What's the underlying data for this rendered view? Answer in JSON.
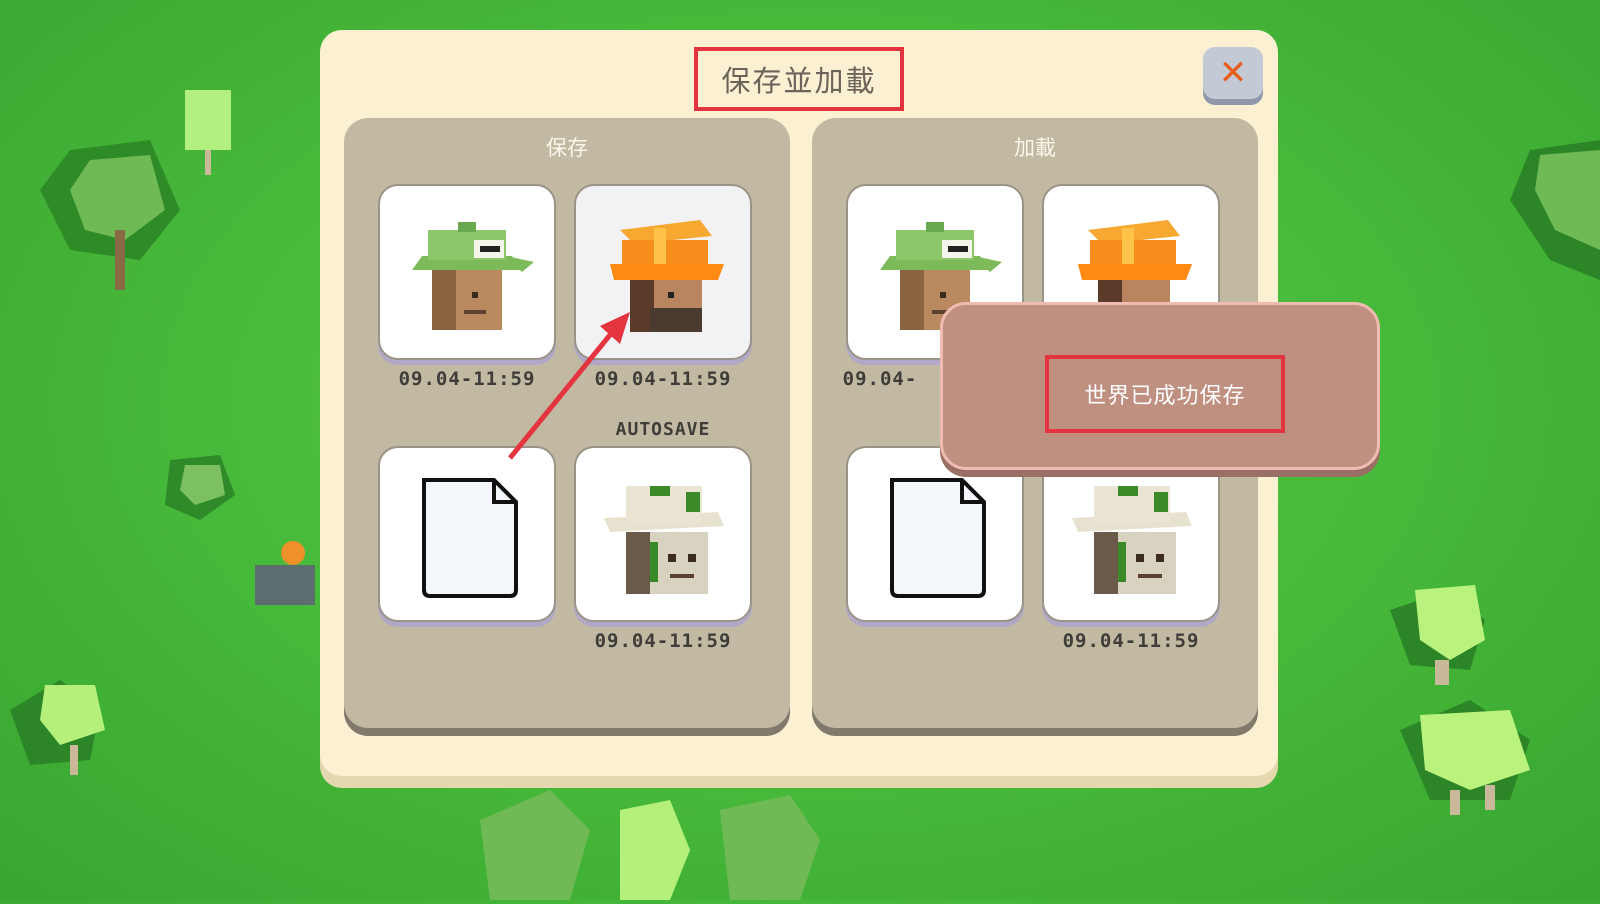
{
  "dialog": {
    "title": "保存並加載",
    "close_icon": "close-x-icon"
  },
  "save_section": {
    "title": "保存",
    "slots": [
      {
        "icon": "green-cap-character-icon",
        "timestamp": "09.04-11:59",
        "tag": ""
      },
      {
        "icon": "orange-hardhat-character-icon",
        "timestamp": "09.04-11:59",
        "tag": ""
      },
      {
        "icon": "empty-file-icon",
        "timestamp": "",
        "tag": ""
      },
      {
        "icon": "stone-golem-character-icon",
        "timestamp": "09.04-11:59",
        "tag": "AUTOSAVE"
      }
    ]
  },
  "load_section": {
    "title": "加載",
    "slots": [
      {
        "icon": "green-cap-character-icon",
        "timestamp": "09.04-"
      },
      {
        "icon": "orange-hardhat-character-icon",
        "timestamp": ""
      },
      {
        "icon": "empty-file-icon",
        "timestamp": ""
      },
      {
        "icon": "stone-golem-character-icon",
        "timestamp": "09.04-11:59"
      }
    ]
  },
  "toast": {
    "message": "世界已成功保存"
  },
  "colors": {
    "highlight_box": "#e3343f",
    "close_x": "#e85d1c",
    "panel": "#fbf1d2",
    "section": "#c1b9a1",
    "toast": "#bf8f80"
  }
}
